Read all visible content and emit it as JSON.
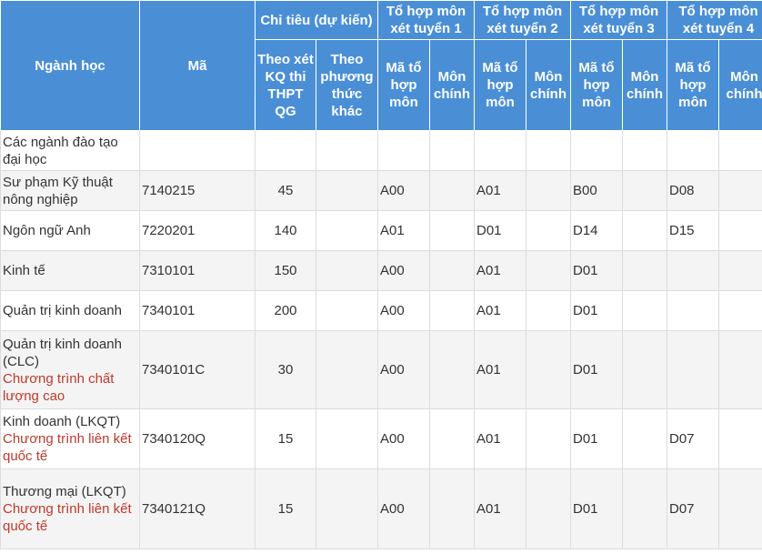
{
  "headers": {
    "nganh": "Ngành học",
    "ma": "Mã",
    "chitieu": "Chỉ tiêu (dự kiến)",
    "theo_thpt": "Theo xét KQ thi THPT QG",
    "theo_khac": "Theo phương thức khác",
    "tohop1": "Tổ hợp môn xét tuyển 1",
    "tohop2": "Tổ hợp môn xét tuyển 2",
    "tohop3": "Tổ hợp môn xét tuyển 3",
    "tohop4": "Tổ hợp môn xét tuyển 4",
    "ma_to_hop": "Mã tổ hợp môn",
    "mon_chinh": "Môn chính"
  },
  "rows": [
    {
      "name": "Các ngành đào tạo đại học",
      "note": "",
      "code": "",
      "quota": "",
      "other": "",
      "c1": "",
      "m1": "",
      "c2": "",
      "m2": "",
      "c3": "",
      "m3": "",
      "c4": "",
      "m4": ""
    },
    {
      "name": "Sư phạm Kỹ thuật nông nghiệp",
      "note": "",
      "code": "7140215",
      "quota": "45",
      "other": "",
      "c1": "A00",
      "m1": "",
      "c2": "A01",
      "m2": "",
      "c3": "B00",
      "m3": "",
      "c4": "D08",
      "m4": ""
    },
    {
      "name": "Ngôn ngữ Anh",
      "note": "",
      "code": "7220201",
      "quota": "140",
      "other": "",
      "c1": "A01",
      "m1": "",
      "c2": "D01",
      "m2": "",
      "c3": "D14",
      "m3": "",
      "c4": "D15",
      "m4": ""
    },
    {
      "name": "Kinh tế",
      "note": "",
      "code": "7310101",
      "quota": "150",
      "other": "",
      "c1": "A00",
      "m1": "",
      "c2": "A01",
      "m2": "",
      "c3": "D01",
      "m3": "",
      "c4": "",
      "m4": ""
    },
    {
      "name": "Quản trị kinh doanh",
      "note": "",
      "code": "7340101",
      "quota": "200",
      "other": "",
      "c1": "A00",
      "m1": "",
      "c2": "A01",
      "m2": "",
      "c3": "D01",
      "m3": "",
      "c4": "",
      "m4": ""
    },
    {
      "name": "Quản trị kinh doanh (CLC)",
      "note": "Chương trình chất lượng cao",
      "code": "7340101C",
      "quota": "30",
      "other": "",
      "c1": "A00",
      "m1": "",
      "c2": "A01",
      "m2": "",
      "c3": "D01",
      "m3": "",
      "c4": "",
      "m4": ""
    },
    {
      "name": "Kinh doanh (LKQT)",
      "note": "Chương trình liên kết quốc tế",
      "code": "7340120Q",
      "quota": "15",
      "other": "",
      "c1": "A00",
      "m1": "",
      "c2": "A01",
      "m2": "",
      "c3": "D01",
      "m3": "",
      "c4": "D07",
      "m4": ""
    },
    {
      "name": "Thương mại (LKQT)",
      "note": "Chương trình liên kết quốc tế",
      "code": "7340121Q",
      "quota": "15",
      "other": "",
      "c1": "A00",
      "m1": "",
      "c2": "A01",
      "m2": "",
      "c3": "D01",
      "m3": "",
      "c4": "D07",
      "m4": ""
    }
  ]
}
